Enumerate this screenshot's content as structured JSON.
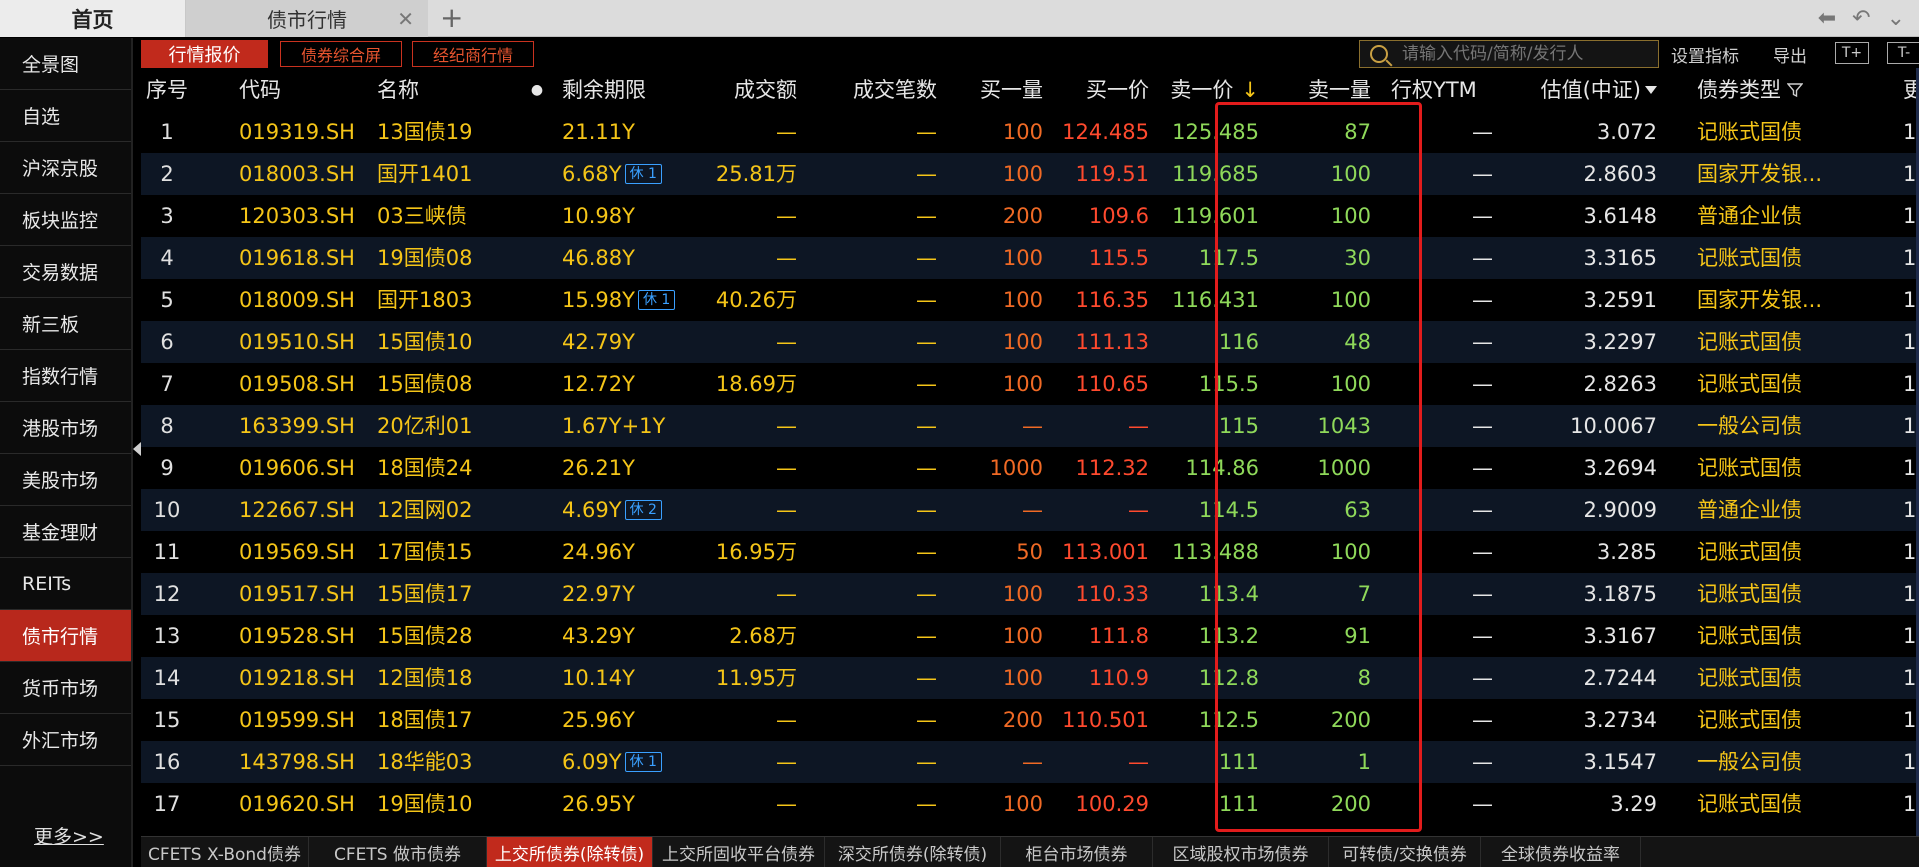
{
  "top_tabs": {
    "home": "首页",
    "doc_tab": "债市行情"
  },
  "sidebar": {
    "items": [
      {
        "label": "全景图"
      },
      {
        "label": "自选"
      },
      {
        "label": "沪深京股"
      },
      {
        "label": "板块监控"
      },
      {
        "label": "交易数据"
      },
      {
        "label": "新三板"
      },
      {
        "label": "指数行情"
      },
      {
        "label": "港股市场"
      },
      {
        "label": "美股市场"
      },
      {
        "label": "基金理财"
      },
      {
        "label": "REITs"
      },
      {
        "label": "债市行情",
        "active": true
      },
      {
        "label": "货币市场"
      },
      {
        "label": "外汇市场"
      }
    ],
    "more": "更多>>"
  },
  "toolbar": {
    "quote_tab": "行情报价",
    "btn_composite": "债券综合屏",
    "btn_broker": "经纪商行情",
    "search_placeholder": "请输入代码/简称/发行人",
    "set_indicator": "设置指标",
    "export": "导出",
    "zoom_in": "T+",
    "zoom_out": "T-"
  },
  "table": {
    "headers": {
      "seq": "序号",
      "code": "代码",
      "name": "名称",
      "dot": "●",
      "term": "剩余期限",
      "amount": "成交额",
      "count": "成交笔数",
      "bid_qty": "买一量",
      "bid": "买一价",
      "ask": "卖一价",
      "ask_sort": "↓",
      "ask_qty": "卖一量",
      "ytm": "行权YTM",
      "valuation": "估值(中证)",
      "type": "债券类型",
      "extra": "更"
    },
    "rows": [
      {
        "seq": "1",
        "code": "019319.SH",
        "name": "13国债19",
        "term": "21.11Y",
        "badge": "",
        "amount": "—",
        "count": "—",
        "bid_qty": "100",
        "bid": "124.485",
        "ask": "125.485",
        "ask_qty": "87",
        "ytm": "—",
        "valuation": "3.072",
        "type": "记账式国债",
        "extra": "1"
      },
      {
        "seq": "2",
        "code": "018003.SH",
        "name": "国开1401",
        "term": "6.68Y",
        "badge": "休 1",
        "amount": "25.81万",
        "count": "—",
        "bid_qty": "100",
        "bid": "119.51",
        "ask": "119.685",
        "ask_qty": "100",
        "ytm": "—",
        "valuation": "2.8603",
        "type": "国家开发银...",
        "extra": "1"
      },
      {
        "seq": "3",
        "code": "120303.SH",
        "name": "03三峡债",
        "term": "10.98Y",
        "badge": "",
        "amount": "—",
        "count": "—",
        "bid_qty": "200",
        "bid": "109.6",
        "ask": "119.601",
        "ask_qty": "100",
        "ytm": "—",
        "valuation": "3.6148",
        "type": "普通企业债",
        "extra": "1"
      },
      {
        "seq": "4",
        "code": "019618.SH",
        "name": "19国债08",
        "term": "46.88Y",
        "badge": "",
        "amount": "—",
        "count": "—",
        "bid_qty": "100",
        "bid": "115.5",
        "ask": "117.5",
        "ask_qty": "30",
        "ytm": "—",
        "valuation": "3.3165",
        "type": "记账式国债",
        "extra": "1"
      },
      {
        "seq": "5",
        "code": "018009.SH",
        "name": "国开1803",
        "term": "15.98Y",
        "badge": "休 1",
        "amount": "40.26万",
        "count": "—",
        "bid_qty": "100",
        "bid": "116.35",
        "ask": "116.431",
        "ask_qty": "100",
        "ytm": "—",
        "valuation": "3.2591",
        "type": "国家开发银...",
        "extra": "1"
      },
      {
        "seq": "6",
        "code": "019510.SH",
        "name": "15国债10",
        "term": "42.79Y",
        "badge": "",
        "amount": "—",
        "count": "—",
        "bid_qty": "100",
        "bid": "111.13",
        "ask": "116",
        "ask_qty": "48",
        "ytm": "—",
        "valuation": "3.2297",
        "type": "记账式国债",
        "extra": "1"
      },
      {
        "seq": "7",
        "code": "019508.SH",
        "name": "15国债08",
        "term": "12.72Y",
        "badge": "",
        "amount": "18.69万",
        "count": "—",
        "bid_qty": "100",
        "bid": "110.65",
        "ask": "115.5",
        "ask_qty": "100",
        "ytm": "—",
        "valuation": "2.8263",
        "type": "记账式国债",
        "extra": "1"
      },
      {
        "seq": "8",
        "code": "163399.SH",
        "name": "20亿利01",
        "term": "1.67Y+1Y",
        "badge": "",
        "amount": "—",
        "count": "—",
        "bid_qty": "—",
        "bid": "—",
        "ask": "115",
        "ask_qty": "1043",
        "ytm": "—",
        "valuation": "10.0067",
        "type": "一般公司债",
        "extra": "1"
      },
      {
        "seq": "9",
        "code": "019606.SH",
        "name": "18国债24",
        "term": "26.21Y",
        "badge": "",
        "amount": "—",
        "count": "—",
        "bid_qty": "1000",
        "bid": "112.32",
        "ask": "114.86",
        "ask_qty": "1000",
        "ytm": "—",
        "valuation": "3.2694",
        "type": "记账式国债",
        "extra": "1"
      },
      {
        "seq": "10",
        "code": "122667.SH",
        "name": "12国网02",
        "term": "4.69Y",
        "badge": "休 2",
        "amount": "—",
        "count": "—",
        "bid_qty": "—",
        "bid": "—",
        "ask": "114.5",
        "ask_qty": "63",
        "ytm": "—",
        "valuation": "2.9009",
        "type": "普通企业债",
        "extra": "1"
      },
      {
        "seq": "11",
        "code": "019569.SH",
        "name": "17国债15",
        "term": "24.96Y",
        "badge": "",
        "amount": "16.95万",
        "count": "—",
        "bid_qty": "50",
        "bid": "113.001",
        "ask": "113.488",
        "ask_qty": "100",
        "ytm": "—",
        "valuation": "3.285",
        "type": "记账式国债",
        "extra": "1"
      },
      {
        "seq": "12",
        "code": "019517.SH",
        "name": "15国债17",
        "term": "22.97Y",
        "badge": "",
        "amount": "—",
        "count": "—",
        "bid_qty": "100",
        "bid": "110.33",
        "ask": "113.4",
        "ask_qty": "7",
        "ytm": "—",
        "valuation": "3.1875",
        "type": "记账式国债",
        "extra": "1"
      },
      {
        "seq": "13",
        "code": "019528.SH",
        "name": "15国债28",
        "term": "43.29Y",
        "badge": "",
        "amount": "2.68万",
        "count": "—",
        "bid_qty": "100",
        "bid": "111.8",
        "ask": "113.2",
        "ask_qty": "91",
        "ytm": "—",
        "valuation": "3.3167",
        "type": "记账式国债",
        "extra": "1"
      },
      {
        "seq": "14",
        "code": "019218.SH",
        "name": "12国债18",
        "term": "10.14Y",
        "badge": "",
        "amount": "11.95万",
        "count": "—",
        "bid_qty": "100",
        "bid": "110.9",
        "ask": "112.8",
        "ask_qty": "8",
        "ytm": "—",
        "valuation": "2.7244",
        "type": "记账式国债",
        "extra": "1"
      },
      {
        "seq": "15",
        "code": "019599.SH",
        "name": "18国债17",
        "term": "25.96Y",
        "badge": "",
        "amount": "—",
        "count": "—",
        "bid_qty": "200",
        "bid": "110.501",
        "ask": "112.5",
        "ask_qty": "200",
        "ytm": "—",
        "valuation": "3.2734",
        "type": "记账式国债",
        "extra": "1"
      },
      {
        "seq": "16",
        "code": "143798.SH",
        "name": "18华能03",
        "term": "6.09Y",
        "badge": "休 1",
        "amount": "—",
        "count": "—",
        "bid_qty": "—",
        "bid": "—",
        "ask": "111",
        "ask_qty": "1",
        "ytm": "—",
        "valuation": "3.1547",
        "type": "一般公司债",
        "extra": "1"
      },
      {
        "seq": "17",
        "code": "019620.SH",
        "name": "19国债10",
        "term": "26.95Y",
        "badge": "",
        "amount": "—",
        "count": "—",
        "bid_qty": "100",
        "bid": "100.29",
        "ask": "111",
        "ask_qty": "200",
        "ytm": "—",
        "valuation": "3.29",
        "type": "记账式国债",
        "extra": "1"
      }
    ]
  },
  "bottom_tabs": [
    {
      "label": "CFETS X-Bond债券"
    },
    {
      "label": "CFETS 做市债券"
    },
    {
      "label": "上交所债券(除转债)",
      "active": true
    },
    {
      "label": "上交所固收平台债券"
    },
    {
      "label": "深交所债券(除转债)"
    },
    {
      "label": "柜台市场债券"
    },
    {
      "label": "区域股权市场债券"
    },
    {
      "label": "可转债/交换债券"
    },
    {
      "label": "全球债券收益率"
    }
  ],
  "colors": {
    "accent_red": "#c12a1c",
    "highlight_box": "#e21c1c",
    "code_yellow": "#f5c518",
    "bid_red": "#ff4a2e",
    "ask_green": "#8fd95a",
    "badge_blue": "#3aa0ff"
  }
}
